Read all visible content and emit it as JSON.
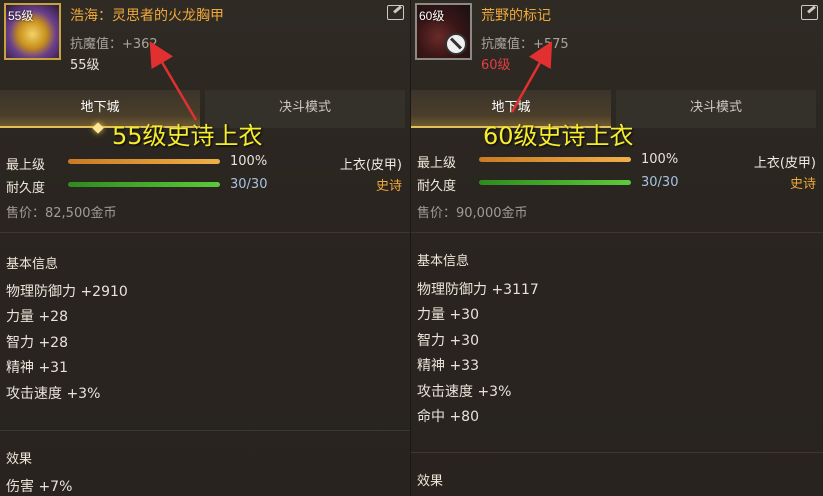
{
  "left": {
    "level_badge": "55级",
    "name": "浩海：灵思者的火龙胸甲",
    "resist": "抗魔值：+362",
    "req_level": "55级",
    "tabs": [
      "地下城",
      "决斗模式"
    ],
    "level_label": "最上级",
    "level_value": "100%",
    "durability_label": "耐久度",
    "durability_value": "30/30",
    "slot": "上衣(皮甲)",
    "rarity": "史诗",
    "price": "售价：82,500金币",
    "basic_title": "基本信息",
    "attributes": [
      "物理防御力 +2910",
      "力量 +28",
      "智力 +28",
      "精神 +31",
      "攻击速度 +3%"
    ],
    "effect_title": "效果",
    "effect_text": "伤害 +7%",
    "annotation": "55级史诗上衣"
  },
  "right": {
    "level_badge": "60级",
    "name": "荒野的标记",
    "resist": "抗魔值：+575",
    "req_level": "60级",
    "tabs": [
      "地下城",
      "决斗模式"
    ],
    "level_label": "最上级",
    "level_value": "100%",
    "durability_label": "耐久度",
    "durability_value": "30/30",
    "slot": "上衣(皮甲)",
    "rarity": "史诗",
    "price": "售价：90,000金币",
    "basic_title": "基本信息",
    "attributes": [
      "物理防御力 +3117",
      "力量 +30",
      "智力 +30",
      "精神 +33",
      "攻击速度 +3%",
      "命中 +80"
    ],
    "effect_title": "效果",
    "annotation": "60级史诗上衣"
  },
  "colors": {
    "item_name": "#f0a83a",
    "annotation": "#f6ec2c",
    "arrow": "#e23030",
    "requirement_unmet": "#e04040"
  },
  "icons": {
    "edit": "edit-icon",
    "restricted": "ban-icon"
  }
}
